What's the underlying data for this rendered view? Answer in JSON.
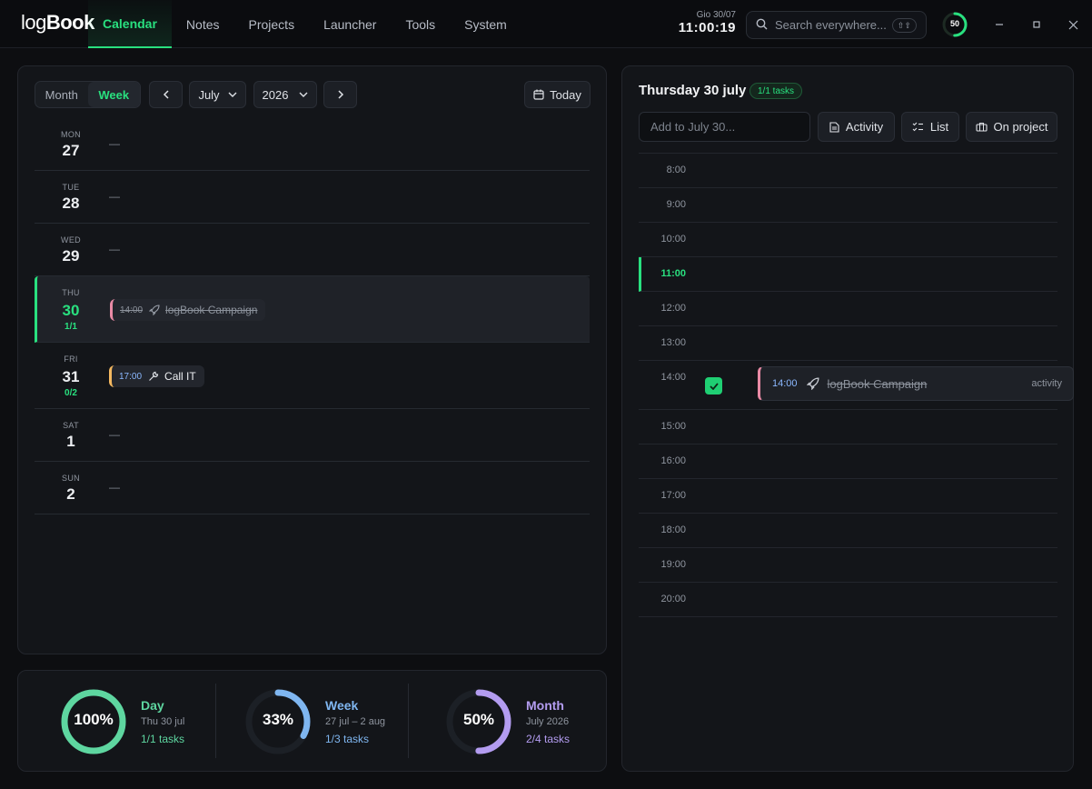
{
  "app": {
    "logo_light": "log",
    "logo_bold": "Book",
    "nav": [
      "Calendar",
      "Notes",
      "Projects",
      "Launcher",
      "Tools",
      "System"
    ],
    "active_nav": "Calendar",
    "date": "Gio 30/07",
    "time": "11:00:19",
    "search_placeholder": "Search everywhere...",
    "search_shortcut": "⇧⇧",
    "progress": 50,
    "progress_label": "50"
  },
  "calendar": {
    "view_month": "Month",
    "view_week": "Week",
    "month": "July",
    "year": "2026",
    "today_label": "Today",
    "days": [
      {
        "dow": "MON",
        "num": "27",
        "empty": "—"
      },
      {
        "dow": "TUE",
        "num": "28",
        "empty": "—"
      },
      {
        "dow": "WED",
        "num": "29",
        "empty": "—"
      },
      {
        "dow": "THU",
        "num": "30",
        "count": "1/1",
        "today": true,
        "event": {
          "time": "14:00",
          "title": "logBook Campaign",
          "done": true,
          "color": "#e98aa5",
          "icon": "rocket-icon"
        }
      },
      {
        "dow": "FRI",
        "num": "31",
        "count": "0/2",
        "event": {
          "time": "17:00",
          "title": "Call IT",
          "done": false,
          "color": "#f4b860",
          "icon": "wrench-icon"
        }
      },
      {
        "dow": "SAT",
        "num": "1",
        "empty": "—"
      },
      {
        "dow": "SUN",
        "num": "2",
        "empty": "—"
      }
    ]
  },
  "stats": [
    {
      "label": "Day",
      "sub": "Thu 30 jul",
      "count": "1/1 tasks",
      "pct_label": "100%",
      "pct": 100,
      "color": "#5ed6a0"
    },
    {
      "label": "Week",
      "sub": "27 jul – 2 aug",
      "count": "1/3 tasks",
      "pct_label": "33%",
      "pct": 33,
      "color": "#7fb6f0"
    },
    {
      "label": "Month",
      "sub": "July 2026",
      "count": "2/4 tasks",
      "pct_label": "50%",
      "pct": 50,
      "color": "#b39cf0"
    }
  ],
  "day": {
    "title": "Thursday 30 july",
    "badge": "1/1 tasks",
    "add_placeholder": "Add to July 30...",
    "activity_label": "Activity",
    "list_label": "List",
    "project_label": "On project",
    "hours": [
      "8:00",
      "9:00",
      "10:00",
      "11:00",
      "12:00",
      "13:00",
      "14:00",
      "15:00",
      "16:00",
      "17:00",
      "18:00",
      "19:00",
      "20:00"
    ],
    "now_hour": "11:00",
    "event": {
      "hour": "14:00",
      "time": "14:00",
      "title": "logBook Campaign",
      "kind": "activity",
      "done": true
    }
  }
}
